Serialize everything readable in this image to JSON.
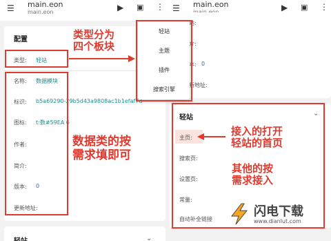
{
  "app": {
    "title": "main.eon",
    "subtitle": "main.eon",
    "menu_icon": "hamburger-icon",
    "play_icon": "play-icon",
    "save_icon": "save-icon",
    "more_icon": "more-vertical-icon"
  },
  "left": {
    "config_title": "配置",
    "type_label": "类型:",
    "type_value": "轻站",
    "fields": [
      {
        "label": "名称:",
        "value": "数据模块"
      },
      {
        "label": "标识:",
        "value": "b5a69290-29b5d43a9808ac1b1efaf7d"
      },
      {
        "label": "图标:",
        "value": "t:数#59EA 6"
      },
      {
        "label": "作者:",
        "value": ""
      },
      {
        "label": "简介:",
        "value": ""
      },
      {
        "label": "版本:",
        "value": "0"
      },
      {
        "label": "更新地址:",
        "value": ""
      }
    ],
    "bottom_section_title": "轻站"
  },
  "dropdown": {
    "items": [
      "轻站",
      "主题",
      "插件",
      "搜索引擎"
    ]
  },
  "right": {
    "partial_rows": [
      "站:",
      "介:",
      "本:",
      "新地址:"
    ],
    "partial_version_value": "0",
    "section_title": "轻站",
    "rows": [
      {
        "label": "主页:"
      },
      {
        "label": "搜索页:"
      },
      {
        "label": "设置页:"
      },
      {
        "label": "常量:"
      },
      {
        "label": "自动补全链接"
      }
    ]
  },
  "annotations": {
    "type_note_line1": "类型分为",
    "type_note_line2": "四个板块",
    "data_note_line1": "数据类的按",
    "data_note_line2": "需求填即可",
    "home_note_line1": "接入的打开",
    "home_note_line2": "轻站的首页",
    "other_note_line1": "其他的按",
    "other_note_line2": "需求接入"
  },
  "watermark": {
    "brand": "闪电下载",
    "url": "www.dianlut.com"
  },
  "colors": {
    "accent": "#1a8f8f",
    "annotation_red": "#e03a2f",
    "background": "#f2f2f2"
  }
}
